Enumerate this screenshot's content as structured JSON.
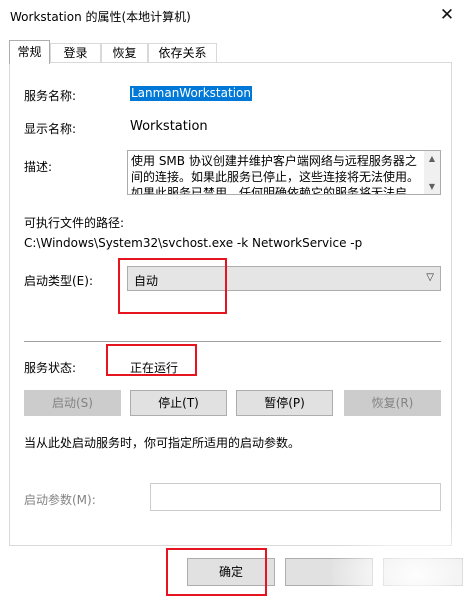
{
  "window": {
    "title": "Workstation 的属性(本地计算机)",
    "close_glyph": "✕"
  },
  "tabs": [
    {
      "label": "常规",
      "active": true
    },
    {
      "label": "登录",
      "active": false
    },
    {
      "label": "恢复",
      "active": false
    },
    {
      "label": "依存关系",
      "active": false
    }
  ],
  "general": {
    "service_name_label": "服务名称:",
    "service_name_value": "LanmanWorkstation",
    "display_name_label": "显示名称:",
    "display_name_value": "Workstation",
    "description_label": "描述:",
    "description_text": "使用 SMB 协议创建并维护客户端网络与远程服务器之间的连接。如果此服务已停止，这些连接将无法使用。如果此服务已禁用，任何明确依赖它的服务将无法启动。",
    "exe_path_label": "可执行文件的路径:",
    "exe_path_value": "C:\\Windows\\System32\\svchost.exe -k NetworkService -p",
    "startup_type_label": "启动类型(E):",
    "startup_type_value": "自动",
    "status_label": "服务状态:",
    "status_value": "正在运行",
    "start_params_hint": "当从此处启动服务时，你可指定所适用的启动参数。",
    "start_params_label": "启动参数(M):",
    "start_params_value": ""
  },
  "service_buttons": [
    {
      "label": "启动(S)",
      "enabled": false
    },
    {
      "label": "停止(T)",
      "enabled": true
    },
    {
      "label": "暂停(P)",
      "enabled": true
    },
    {
      "label": "恢复(R)",
      "enabled": false
    }
  ],
  "footer": {
    "ok_label": "确定",
    "cancel_label": "",
    "apply_label": ""
  },
  "colors": {
    "highlight": "#e5141e",
    "selection": "#0078d7"
  }
}
